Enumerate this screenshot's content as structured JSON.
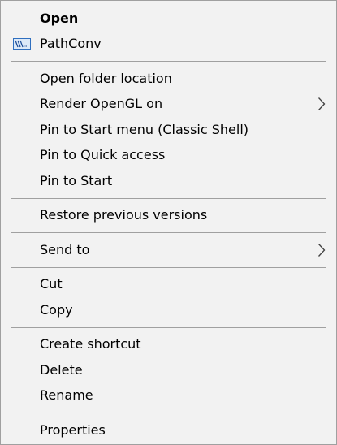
{
  "items": {
    "open": "Open",
    "pathconv": "PathConv",
    "open_folder_location": "Open folder location",
    "render_opengl_on": "Render OpenGL on",
    "pin_classic_shell": "Pin to Start menu (Classic Shell)",
    "pin_quick_access": "Pin to Quick access",
    "pin_to_start": "Pin to Start",
    "restore_previous_versions": "Restore previous versions",
    "send_to": "Send to",
    "cut": "Cut",
    "copy": "Copy",
    "create_shortcut": "Create shortcut",
    "delete": "Delete",
    "rename": "Rename",
    "properties": "Properties"
  },
  "icons": {
    "pathconv": "pathconv-app-icon",
    "submenu": "chevron-right-icon"
  },
  "colors": {
    "menu_background": "#f2f2f2",
    "separator": "#a0a0a0",
    "icon_accent": "#2f6fbf"
  }
}
